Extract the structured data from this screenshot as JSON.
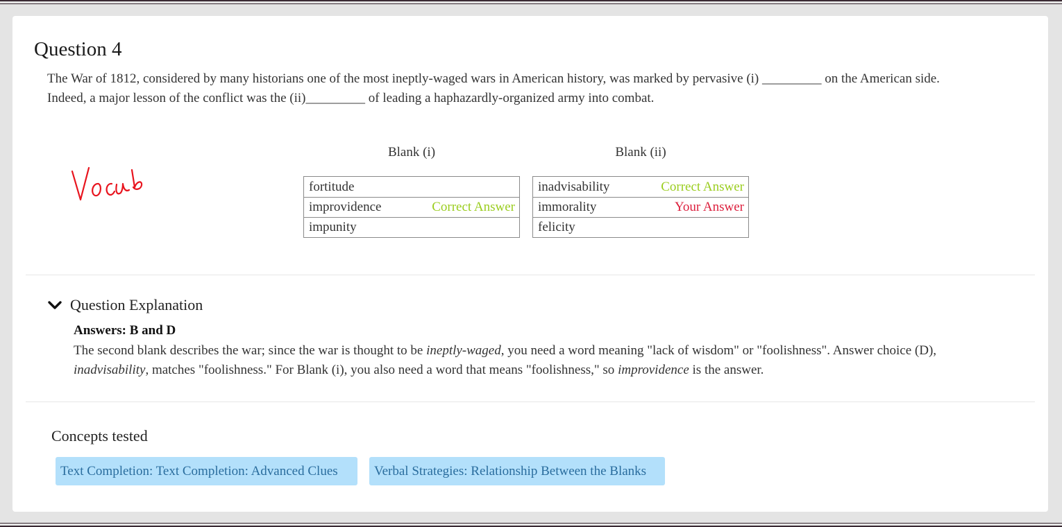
{
  "question": {
    "title": "Question 4",
    "text_line1": "The War of 1812, considered by many historians one of the most ineptly-waged wars in American history, was marked by pervasive (i) _________ on the American side.",
    "text_line2": "Indeed, a major lesson of the conflict was the (ii)_________ of leading a haphazardly-organized army into combat.",
    "handwritten_note": "Vocab"
  },
  "blanks": [
    {
      "header": "Blank (i)",
      "options": [
        {
          "label": "fortitude",
          "tag": ""
        },
        {
          "label": "improvidence",
          "tag": "Correct Answer"
        },
        {
          "label": "impunity",
          "tag": ""
        }
      ]
    },
    {
      "header": "Blank (ii)",
      "options": [
        {
          "label": "inadvisability",
          "tag": "Correct Answer"
        },
        {
          "label": "immorality",
          "tag": "Your Answer"
        },
        {
          "label": "felicity",
          "tag": ""
        }
      ]
    }
  ],
  "explanation": {
    "toggle_label": "Question Explanation",
    "toggle_icon": "chevron-down-icon",
    "answers": "Answers: B and D",
    "body": {
      "s1": "The second blank describes the war; since the war is thought to be ",
      "s2": "ineptly-waged",
      "s3": ", you need a word meaning \"lack of wisdom\" or \"foolishness\". Answer choice (D),",
      "s4": "inadvisability",
      "s5": ", matches \"foolishness.\" For Blank (i), you also need a word that means \"foolishness,\" so ",
      "s6": "improvidence",
      "s7": " is the answer."
    }
  },
  "concepts": {
    "title": "Concepts tested",
    "chips": [
      "Text Completion: Text Completion: Advanced Clues",
      "Verbal Strategies: Relationship Between the Blanks"
    ]
  },
  "colors": {
    "correct": "#9acd1e",
    "yours": "#dc1e3c",
    "chip_bg": "#b3e0fb",
    "chip_text": "#2a6d9e",
    "handwriting": "#e8141e"
  }
}
